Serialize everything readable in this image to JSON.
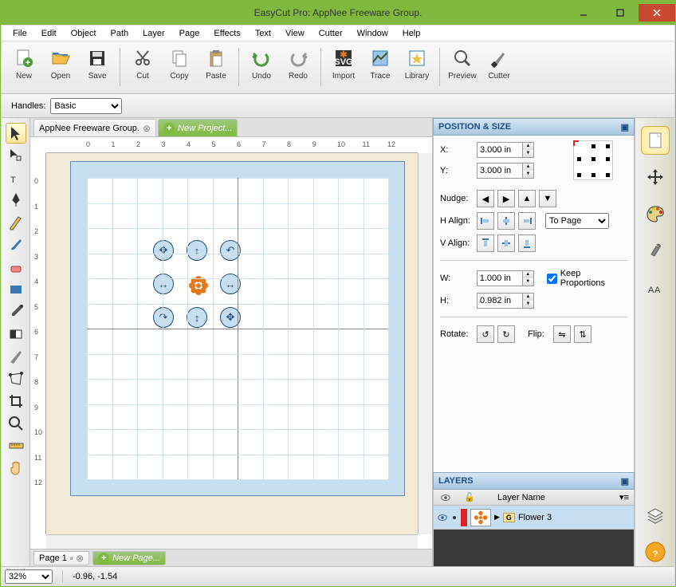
{
  "title": "EasyCut Pro: AppNee Freeware Group.",
  "menus": [
    "File",
    "Edit",
    "Object",
    "Path",
    "Layer",
    "Page",
    "Effects",
    "Text",
    "View",
    "Cutter",
    "Window",
    "Help"
  ],
  "toolbar": [
    {
      "label": "New",
      "icon": "doc-plus"
    },
    {
      "label": "Open",
      "icon": "folder-open"
    },
    {
      "label": "Save",
      "icon": "floppy"
    },
    {
      "sep": true
    },
    {
      "label": "Cut",
      "icon": "scissors"
    },
    {
      "label": "Copy",
      "icon": "copy"
    },
    {
      "label": "Paste",
      "icon": "paste"
    },
    {
      "sep": true
    },
    {
      "label": "Undo",
      "icon": "undo"
    },
    {
      "label": "Redo",
      "icon": "redo"
    },
    {
      "sep": true
    },
    {
      "label": "Import",
      "icon": "svg"
    },
    {
      "label": "Trace",
      "icon": "trace"
    },
    {
      "label": "Library",
      "icon": "star"
    },
    {
      "sep": true
    },
    {
      "label": "Preview",
      "icon": "zoom"
    },
    {
      "label": "Cutter",
      "icon": "knife"
    }
  ],
  "options": {
    "handles_label": "Handles:",
    "handles_value": "Basic"
  },
  "tabs": {
    "t0": "AppNee Freeware Group.",
    "t1": "New Project..."
  },
  "ruler_ticks": [
    "0",
    "1",
    "2",
    "3",
    "4",
    "5",
    "6",
    "7",
    "8",
    "9",
    "10",
    "11",
    "12"
  ],
  "position_size": {
    "title": "POSITION & SIZE",
    "x_label": "X:",
    "x_value": "3.000 in",
    "y_label": "Y:",
    "y_value": "3.000 in",
    "nudge_label": "Nudge:",
    "halign_label": "H Align:",
    "valign_label": "V Align:",
    "align_rel_value": "To Page",
    "w_label": "W:",
    "w_value": "1.000 in",
    "h_label": "H:",
    "h_value": "0.982 in",
    "keep_prop_label": "Keep Proportions",
    "keep_prop_checked": true,
    "rotate_label": "Rotate:",
    "flip_label": "Flip:"
  },
  "layers": {
    "title": "LAYERS",
    "col_name": "Layer Name",
    "item_name": "Flower 3",
    "group_badge": "G"
  },
  "pagebar": {
    "p0": "Page 1",
    "newp": "New Page..."
  },
  "status": {
    "zoom": "32%",
    "coords": "-0.96, -1.54"
  }
}
